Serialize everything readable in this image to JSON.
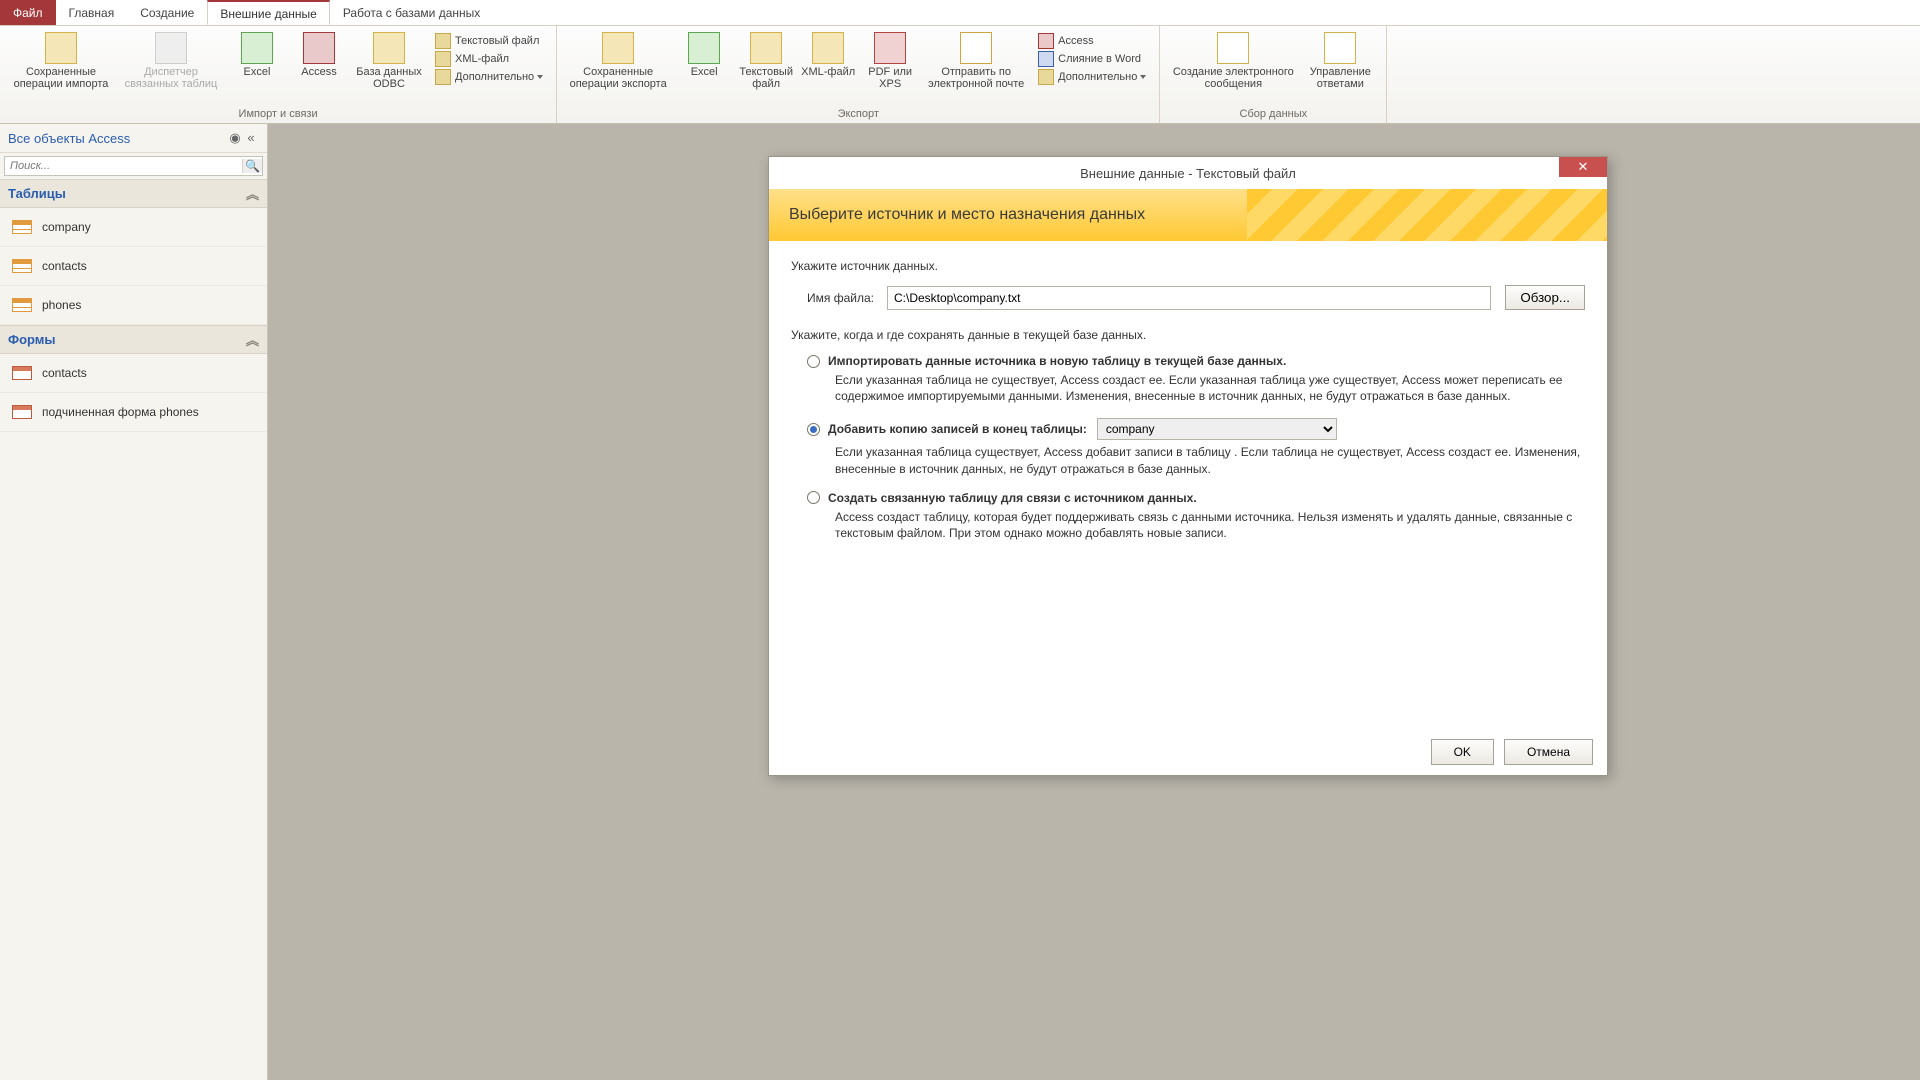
{
  "tabs": {
    "file": "Файл",
    "home": "Главная",
    "create": "Создание",
    "external": "Внешние данные",
    "dbwork": "Работа с базами данных"
  },
  "ribbon": {
    "g1": {
      "saved_import": "Сохраненные операции импорта",
      "link_mgr": "Диспетчер связанных таблиц",
      "excel": "Excel",
      "access": "Access",
      "odbc": "База данных ODBC",
      "textfile": "Текстовый файл",
      "xmlfile": "XML-файл",
      "more": "Дополнительно",
      "label": "Импорт и связи"
    },
    "g2": {
      "saved_export": "Сохраненные операции экспорта",
      "excel": "Excel",
      "textfile": "Текстовый файл",
      "xmlfile": "XML-файл",
      "pdf": "PDF или XPS",
      "email": "Отправить по электронной почте",
      "access": "Access",
      "word": "Слияние в Word",
      "more": "Дополнительно",
      "label": "Экспорт"
    },
    "g3": {
      "create_msg": "Создание электронного сообщения",
      "manage_resp": "Управление ответами",
      "label": "Сбор данных"
    }
  },
  "nav": {
    "header": "Все объекты Access",
    "search_ph": "Поиск...",
    "cat_tables": "Таблицы",
    "tables": [
      "company",
      "contacts",
      "phones"
    ],
    "cat_forms": "Формы",
    "forms": [
      "contacts",
      "подчиненная форма phones"
    ]
  },
  "dialog": {
    "title": "Внешние данные - Текстовый файл",
    "heading": "Выберите источник и место назначения данных",
    "p1": "Укажите источник данных.",
    "file_label": "Имя файла:",
    "file_value": "C:\\Desktop\\company.txt",
    "browse": "Обзор...",
    "p2": "Укажите, когда и где сохранять данные в текущей базе данных.",
    "opt1_title": "Импортировать данные источника в новую таблицу в текущей базе данных.",
    "opt1_desc": "Если указанная таблица не существует, Access создаст ее. Если указанная таблица уже существует, Access может переписать ее содержимое импортируемыми данными. Изменения, внесенные в источник данных, не будут отражаться в базе данных.",
    "opt2_title": "Добавить копию записей в конец таблицы:",
    "opt2_select": "company",
    "opt2_desc": "Если указанная таблица существует, Access добавит записи в таблицу . Если таблица не существует, Access создаст ее. Изменения, внесенные в источник данных, не будут отражаться в базе данных.",
    "opt3_title": "Создать связанную таблицу для связи с источником данных.",
    "opt3_desc": "Access создаст таблицу, которая будет поддерживать связь с данными источника. Нельзя изменять и удалять данные, связанные с текстовым файлом. При этом однако можно добавлять новые записи.",
    "ok": "OK",
    "cancel": "Отмена"
  }
}
